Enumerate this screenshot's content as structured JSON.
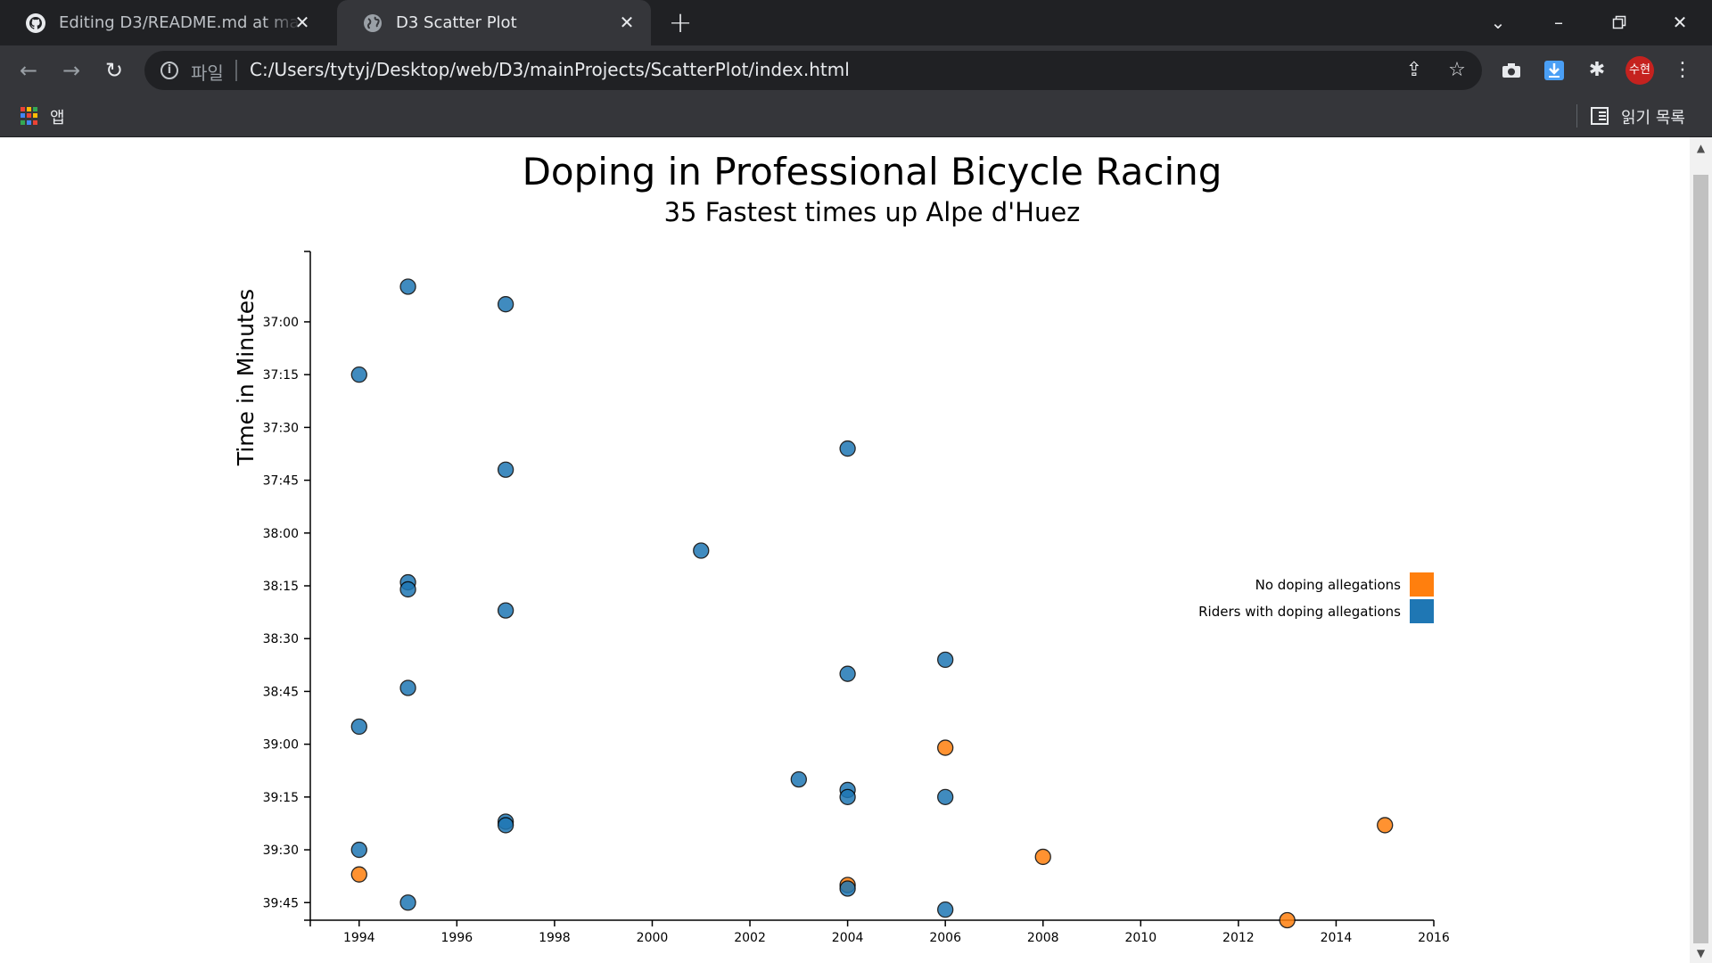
{
  "browser": {
    "tabs": [
      {
        "title": "Editing D3/README.md at main",
        "icon": "github-icon",
        "active": false
      },
      {
        "title": "D3 Scatter Plot",
        "icon": "globe-icon",
        "active": true
      }
    ],
    "address_bar": {
      "scheme_label": "파일",
      "url": "C:/Users/tytyj/Desktop/web/D3/mainProjects/ScatterPlot/index.html"
    },
    "avatar_label": "수현",
    "bookmarks": {
      "apps_label": "앱",
      "reading_list_label": "읽기 목록"
    }
  },
  "colors": {
    "no_doping": "#ff7f0e",
    "doping": "#1f77b4",
    "tabbar_bg": "#202124",
    "toolbar_bg": "#35363a"
  },
  "chart_data": {
    "type": "scatter",
    "title": "Doping in Professional Bicycle Racing",
    "subtitle": "35 Fastest times up Alpe d'Huez",
    "ylabel": "Time in Minutes",
    "xlabel": "",
    "xlim": [
      1993,
      2016
    ],
    "ylim_seconds": [
      2200,
      2390
    ],
    "x_ticks": [
      "1994",
      "1996",
      "1998",
      "2000",
      "2002",
      "2004",
      "2006",
      "2008",
      "2010",
      "2012",
      "2014",
      "2016"
    ],
    "y_ticks": [
      "37:00",
      "37:15",
      "37:30",
      "37:45",
      "38:00",
      "38:15",
      "38:30",
      "38:45",
      "39:00",
      "39:15",
      "39:30",
      "39:45"
    ],
    "legend": [
      {
        "label": "No doping allegations",
        "color": "#ff7f0e"
      },
      {
        "label": "Riders with doping allegations",
        "color": "#1f77b4"
      }
    ],
    "legend_position": "right",
    "points": [
      {
        "year": 1995,
        "time": "36:50",
        "doping": true
      },
      {
        "year": 1997,
        "time": "36:55",
        "doping": true
      },
      {
        "year": 1994,
        "time": "37:15",
        "doping": true
      },
      {
        "year": 2004,
        "time": "37:36",
        "doping": true
      },
      {
        "year": 1997,
        "time": "37:42",
        "doping": true
      },
      {
        "year": 2001,
        "time": "38:05",
        "doping": true
      },
      {
        "year": 1995,
        "time": "38:14",
        "doping": true
      },
      {
        "year": 1995,
        "time": "38:16",
        "doping": true
      },
      {
        "year": 1997,
        "time": "38:22",
        "doping": true
      },
      {
        "year": 2006,
        "time": "38:36",
        "doping": true
      },
      {
        "year": 2004,
        "time": "38:40",
        "doping": true
      },
      {
        "year": 1995,
        "time": "38:44",
        "doping": true
      },
      {
        "year": 1994,
        "time": "38:55",
        "doping": true
      },
      {
        "year": 2006,
        "time": "39:01",
        "doping": false
      },
      {
        "year": 2003,
        "time": "39:10",
        "doping": true
      },
      {
        "year": 2004,
        "time": "39:13",
        "doping": true
      },
      {
        "year": 2004,
        "time": "39:15",
        "doping": true
      },
      {
        "year": 2006,
        "time": "39:15",
        "doping": true
      },
      {
        "year": 1997,
        "time": "39:22",
        "doping": true
      },
      {
        "year": 1997,
        "time": "39:23",
        "doping": true
      },
      {
        "year": 2015,
        "time": "39:23",
        "doping": false
      },
      {
        "year": 1994,
        "time": "39:30",
        "doping": true
      },
      {
        "year": 2008,
        "time": "39:32",
        "doping": false
      },
      {
        "year": 1994,
        "time": "39:37",
        "doping": false
      },
      {
        "year": 2004,
        "time": "39:40",
        "doping": false
      },
      {
        "year": 2004,
        "time": "39:41",
        "doping": true
      },
      {
        "year": 1995,
        "time": "39:45",
        "doping": true
      },
      {
        "year": 2006,
        "time": "39:47",
        "doping": true
      },
      {
        "year": 2013,
        "time": "39:50",
        "doping": false
      }
    ]
  }
}
